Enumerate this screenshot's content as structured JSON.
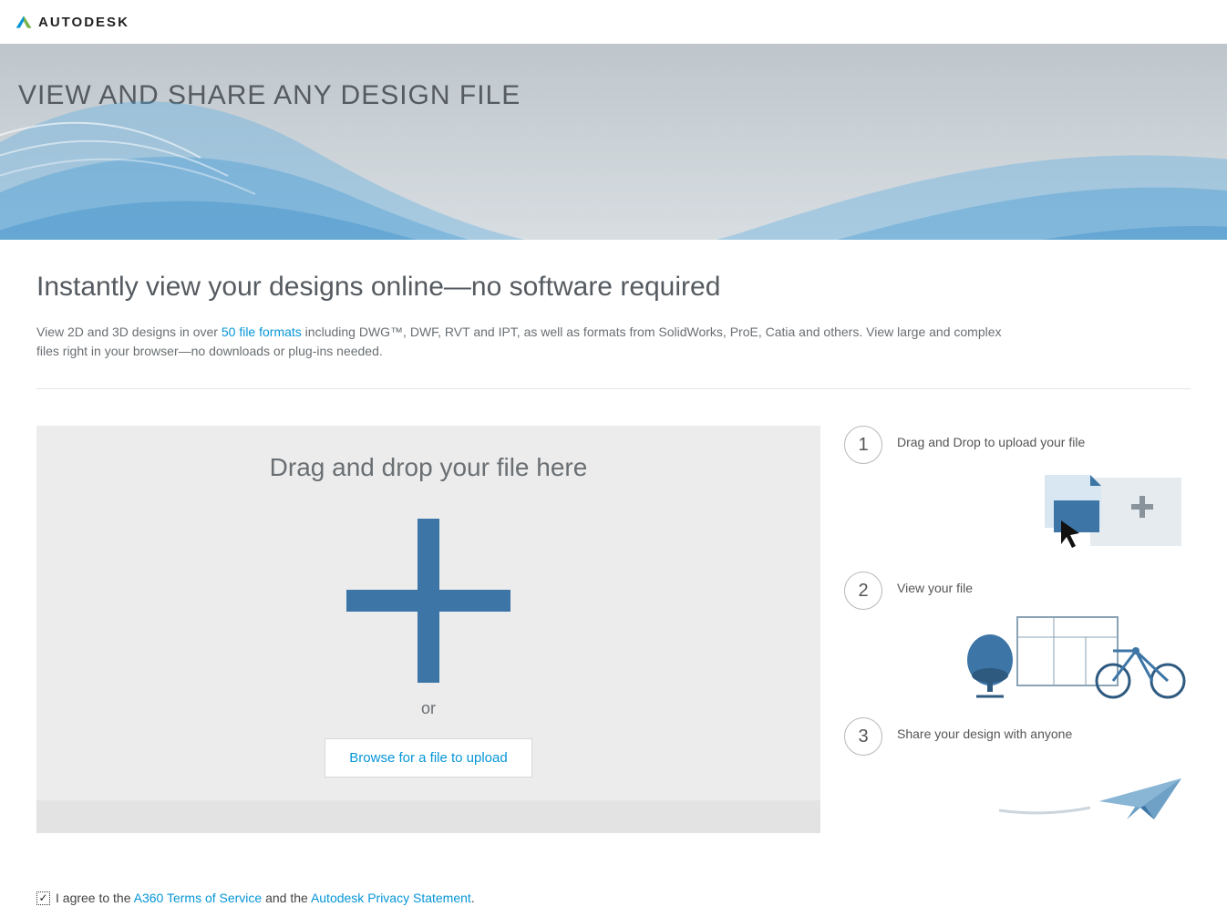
{
  "brand": {
    "name": "AUTODESK"
  },
  "hero": {
    "title": "VIEW AND SHARE ANY DESIGN FILE"
  },
  "intro": {
    "headline": "Instantly view your designs online—no software required",
    "text_before_link": "View 2D and 3D designs in over ",
    "link_text": "50 file formats",
    "text_after_link": " including DWG™, DWF, RVT and IPT, as well as formats from SolidWorks, ProE, Catia and others. View large and complex files right in your browser—no downloads or plug-ins needed."
  },
  "dropzone": {
    "title": "Drag and drop your file here",
    "or": "or",
    "browse_label": "Browse for a file to upload"
  },
  "steps": [
    {
      "num": "1",
      "label": "Drag and Drop to upload your file"
    },
    {
      "num": "2",
      "label": "View your file"
    },
    {
      "num": "3",
      "label": "Share your design with anyone"
    }
  ],
  "agree": {
    "prefix": "I agree to the ",
    "tos": "A360 Terms of Service",
    "middle": " and the ",
    "privacy": "Autodesk Privacy Statement",
    "suffix": "."
  },
  "colors": {
    "accent": "#0696d7",
    "plus": "#3d76a6"
  }
}
